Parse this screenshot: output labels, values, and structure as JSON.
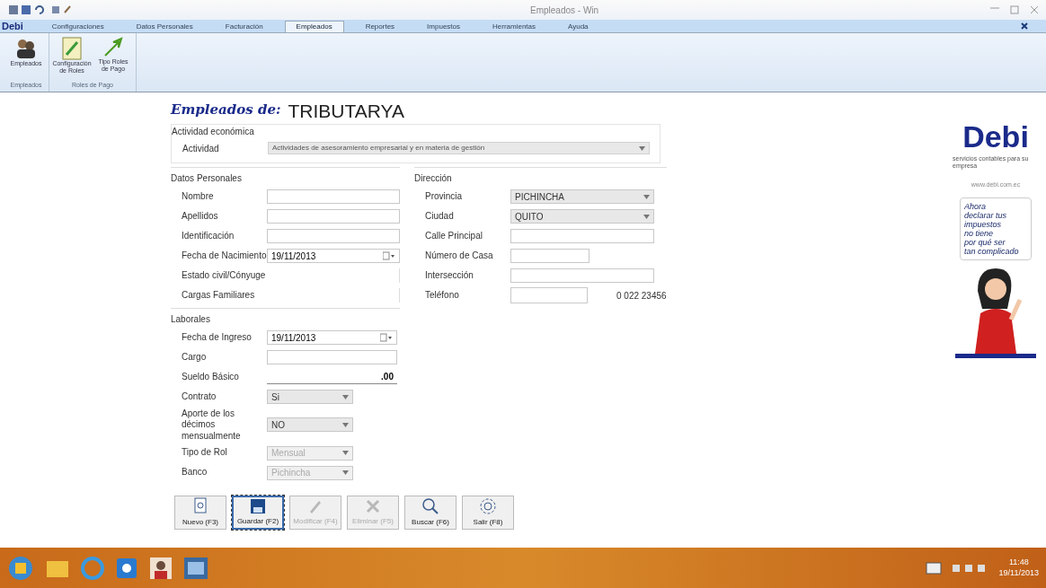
{
  "window": {
    "title": "Empleados - Win",
    "app_logo": "Debi"
  },
  "ribbon": {
    "tabs": [
      {
        "label": "Configuraciones",
        "selected": false
      },
      {
        "label": "Datos Personales",
        "selected": false
      },
      {
        "label": "Facturación",
        "selected": false
      },
      {
        "label": "Empleados",
        "selected": true
      },
      {
        "label": "Reportes",
        "selected": false
      },
      {
        "label": "Impuestos",
        "selected": false
      },
      {
        "label": "Herramientas",
        "selected": false
      },
      {
        "label": "Ayuda",
        "selected": false
      }
    ],
    "groups": [
      {
        "label": "Empleados",
        "buttons": [
          {
            "label": "Empleados",
            "kind": "people"
          }
        ]
      },
      {
        "label": "Roles de Pago",
        "buttons": [
          {
            "label": "Configuración de Roles",
            "kind": "document"
          },
          {
            "label": "Tipo Roles de Pago",
            "kind": "arrow"
          }
        ]
      }
    ]
  },
  "form": {
    "heading": "Empleados de:",
    "company": "TRIBUTARYA",
    "activity": {
      "legend": "Actividad económica",
      "label": "Actividad",
      "value": "Actividades de asesoramiento empresarial y en materia de gestión"
    },
    "personal": {
      "legend": "Datos Personales",
      "fields": [
        {
          "label": "Nombre",
          "kind": "text"
        },
        {
          "label": "Apellidos",
          "kind": "text"
        },
        {
          "label": "Identificación",
          "kind": "text"
        },
        {
          "label": "Fecha de Nacimiento",
          "kind": "date",
          "value": "19/11/2013"
        },
        {
          "label": "Estado civil/Cónyuge",
          "kind": "blank"
        },
        {
          "label": "Cargas Familiares",
          "kind": "blank"
        }
      ]
    },
    "address": {
      "legend": "Dirección",
      "fields": [
        {
          "label": "Provincia",
          "kind": "select",
          "value": "PICHINCHA"
        },
        {
          "label": "Ciudad",
          "kind": "select",
          "value": "QUITO"
        },
        {
          "label": "Calle Principal",
          "kind": "text"
        },
        {
          "label": "Número de Casa",
          "kind": "short"
        },
        {
          "label": "Intersección",
          "kind": "text"
        },
        {
          "label": "Teléfono",
          "kind": "phone",
          "value": "0 022 23456"
        }
      ]
    },
    "work": {
      "legend": "Laborales",
      "fields": [
        {
          "label": "Fecha de Ingreso",
          "kind": "date",
          "value": "19/11/2013"
        },
        {
          "label": "Cargo",
          "kind": "text"
        },
        {
          "label": "Sueldo Básico",
          "kind": "number",
          "value": ".00"
        },
        {
          "label": "Contrato",
          "kind": "select",
          "value": "Si",
          "disabled": false
        },
        {
          "label": "Aporte de los décimos mensualmente",
          "kind": "select",
          "value": "NO",
          "disabled": false
        },
        {
          "label": "Tipo de Rol",
          "kind": "select",
          "value": "Mensual",
          "disabled": true
        },
        {
          "label": "Banco",
          "kind": "select",
          "value": "Pichincha",
          "disabled": true
        }
      ]
    },
    "buttons": [
      {
        "label": "Nuevo (F3)",
        "kind": "new",
        "disabled": false,
        "selected": false
      },
      {
        "label": "Guardar (F2)",
        "kind": "save",
        "disabled": false,
        "selected": true
      },
      {
        "label": "Modificar (F4)",
        "kind": "edit",
        "disabled": true,
        "selected": false
      },
      {
        "label": "Eliminar (F5)",
        "kind": "delete",
        "disabled": true,
        "selected": false
      },
      {
        "label": "Buscar (F6)",
        "kind": "search",
        "disabled": false,
        "selected": false
      },
      {
        "label": "Salir (F8)",
        "kind": "exit",
        "disabled": false,
        "selected": false
      }
    ]
  },
  "ad": {
    "logo": "Debi",
    "tagline": "servicios contables para su empresa",
    "url": "www.debi.com.ec",
    "bubble": [
      "Ahora",
      "declarar tus",
      "impuestos",
      "no tiene",
      "por qué ser",
      "tan complicado"
    ]
  },
  "taskbar": {
    "time": "11:48",
    "date": "19/11/2013"
  }
}
